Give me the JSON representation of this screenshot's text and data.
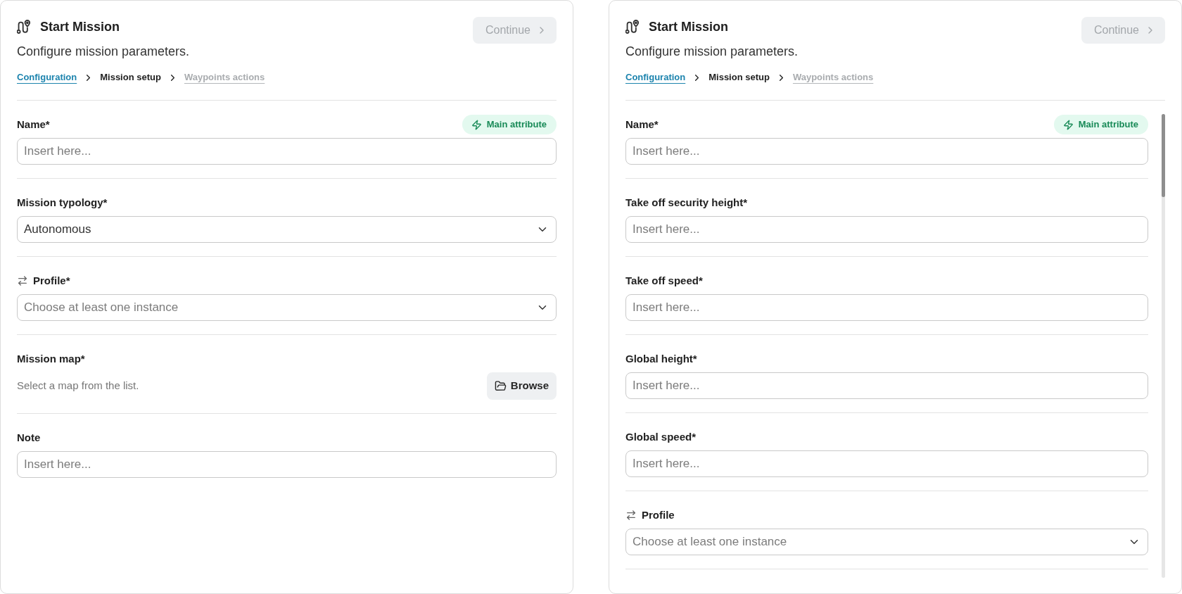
{
  "panels": [
    {
      "title": "Start Mission",
      "subtitle": "Configure mission parameters.",
      "continue_button": {
        "label": "Continue",
        "disabled": true
      },
      "breadcrumb": [
        {
          "label": "Configuration",
          "selected": false,
          "disabled": false
        },
        {
          "label": "Mission setup",
          "selected": true,
          "disabled": false
        },
        {
          "label": "Waypoints actions",
          "selected": false,
          "disabled": true
        }
      ],
      "scrollable": false,
      "fields": [
        {
          "kind": "text",
          "label": "Name*",
          "badge": "Main attribute",
          "placeholder": "Insert here..."
        },
        {
          "kind": "select",
          "label": "Mission typology*",
          "value": "Autonomous"
        },
        {
          "kind": "relation",
          "label": "Profile*",
          "placeholder": "Choose at least one instance"
        },
        {
          "kind": "map",
          "label": "Mission map*",
          "hint": "Select a map from the list.",
          "button": "Browse"
        },
        {
          "kind": "text",
          "label": "Note",
          "placeholder": "Insert here..."
        }
      ]
    },
    {
      "title": "Start Mission",
      "subtitle": "Configure mission parameters.",
      "continue_button": {
        "label": "Continue",
        "disabled": true
      },
      "breadcrumb": [
        {
          "label": "Configuration",
          "selected": false,
          "disabled": false
        },
        {
          "label": "Mission setup",
          "selected": true,
          "disabled": false
        },
        {
          "label": "Waypoints actions",
          "selected": false,
          "disabled": true
        }
      ],
      "scrollable": true,
      "fields": [
        {
          "kind": "text",
          "label": "Name*",
          "badge": "Main attribute",
          "placeholder": "Insert here..."
        },
        {
          "kind": "text",
          "label": "Take off security height*",
          "placeholder": "Insert here..."
        },
        {
          "kind": "text",
          "label": "Take off speed*",
          "placeholder": "Insert here..."
        },
        {
          "kind": "text",
          "label": "Global height*",
          "placeholder": "Insert here..."
        },
        {
          "kind": "text",
          "label": "Global speed*",
          "placeholder": "Insert here..."
        },
        {
          "kind": "relation",
          "label": "Profile",
          "placeholder": "Choose at least one instance"
        }
      ]
    }
  ]
}
